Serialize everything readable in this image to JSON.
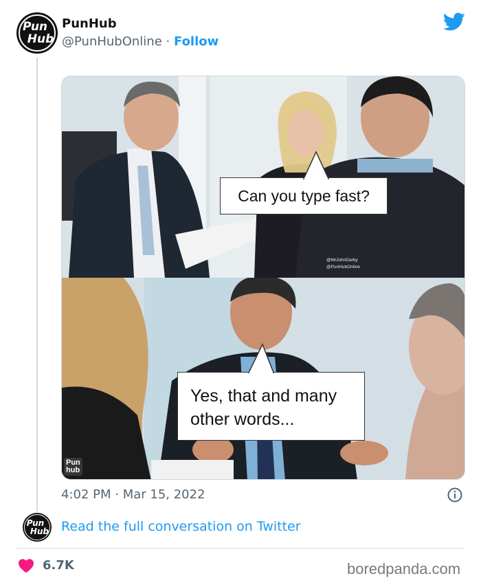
{
  "tweet": {
    "author": {
      "name": "PunHub",
      "handle": "@PunHubOnline",
      "avatar_text_line1": "Pun",
      "avatar_text_line2": "Hub"
    },
    "separator": "·",
    "follow_label": "Follow",
    "media": {
      "top_panel_caption": "Can you type fast?",
      "bottom_panel_caption": "Yes, that and many other words...",
      "credit_line1": "@MrJohnDarby",
      "credit_line2": "@PunHubOnline",
      "watermark_line1": "Pun",
      "watermark_line2": "hub"
    },
    "timestamp": "4:02 PM · Mar 15, 2022",
    "read_full_label": "Read the full conversation on Twitter",
    "likes_count": "6.7K"
  },
  "footer": {
    "source_brand": "boredpanda.com"
  },
  "colors": {
    "accent": "#1d9bf0",
    "like": "#f91880",
    "muted_text": "#536471"
  },
  "icons": [
    "twitter-icon",
    "info-icon",
    "heart-icon"
  ]
}
